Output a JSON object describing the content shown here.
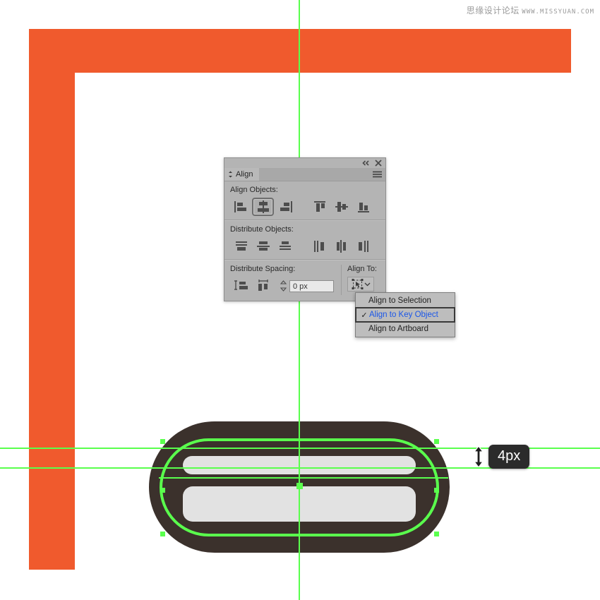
{
  "watermark": {
    "cjk": "思缘设计论坛",
    "url": "WWW.MISSYUAN.COM"
  },
  "colors": {
    "artboard_border": "#f05a2d",
    "canvas": "#ffffff",
    "guide_green": "#5aff4d",
    "shape_dark": "#3b312c",
    "shape_light": "#e2e2e2",
    "panel_bg": "#b4b4b4",
    "menu_highlight_text": "#1a56e8",
    "tooltip_bg": "#2b2b2b"
  },
  "align_panel": {
    "tab_label": "Align",
    "titlebar": {
      "collapse_icon": "double-chevron-left-icon",
      "close_icon": "close-icon",
      "menu_icon": "panel-menu-icon"
    },
    "sections": [
      {
        "label": "Align Objects:",
        "buttons": [
          {
            "name": "align-left-button",
            "icon": "align-horizontal-left-icon",
            "selected": false
          },
          {
            "name": "align-horizontal-center-button",
            "icon": "align-horizontal-center-icon",
            "selected": true
          },
          {
            "name": "align-right-button",
            "icon": "align-horizontal-right-icon",
            "selected": false
          },
          {
            "name": "align-top-button",
            "icon": "align-vertical-top-icon",
            "selected": false
          },
          {
            "name": "align-vertical-center-button",
            "icon": "align-vertical-center-icon",
            "selected": false
          },
          {
            "name": "align-bottom-button",
            "icon": "align-vertical-bottom-icon",
            "selected": false
          }
        ]
      },
      {
        "label": "Distribute Objects:",
        "buttons": [
          {
            "name": "distribute-vertical-top-button",
            "icon": "distribute-vertical-top-icon",
            "selected": false
          },
          {
            "name": "distribute-vertical-center-button",
            "icon": "distribute-vertical-center-icon",
            "selected": false
          },
          {
            "name": "distribute-vertical-bottom-button",
            "icon": "distribute-vertical-bottom-icon",
            "selected": false
          },
          {
            "name": "distribute-horizontal-left-button",
            "icon": "distribute-horizontal-left-icon",
            "selected": false
          },
          {
            "name": "distribute-horizontal-center-button",
            "icon": "distribute-horizontal-center-icon",
            "selected": false
          },
          {
            "name": "distribute-horizontal-right-button",
            "icon": "distribute-horizontal-right-icon",
            "selected": false
          }
        ]
      }
    ],
    "distribute_spacing": {
      "label": "Distribute Spacing:",
      "buttons": [
        {
          "name": "distribute-spacing-vertical-button",
          "icon": "distribute-spacing-vertical-icon"
        },
        {
          "name": "distribute-spacing-horizontal-button",
          "icon": "distribute-spacing-horizontal-icon"
        }
      ],
      "value": "0 px",
      "stepper_icon": "stepper-up-down-icon"
    },
    "align_to": {
      "label": "Align To:",
      "button_icon": "align-to-key-object-icon",
      "chevron_icon": "chevron-down-icon"
    }
  },
  "align_dropdown": {
    "items": [
      {
        "label": "Align to Selection",
        "checked": false,
        "highlighted": false
      },
      {
        "label": "Align to Key Object",
        "checked": true,
        "highlighted": true
      },
      {
        "label": "Align to Artboard",
        "checked": false,
        "highlighted": false
      }
    ],
    "check_glyph": "✓"
  },
  "measurement": {
    "value": "4px",
    "arrow_icon": "vertical-double-arrow-icon"
  },
  "canvas_objects": {
    "shape_name": "rounded-rectangle-vector-shape",
    "selection_path_name": "selected-path-outline",
    "center_anchor_name": "center-anchor-point"
  },
  "guides": {
    "vertical": [
      424
    ],
    "horizontal": [
      635,
      663
    ]
  }
}
